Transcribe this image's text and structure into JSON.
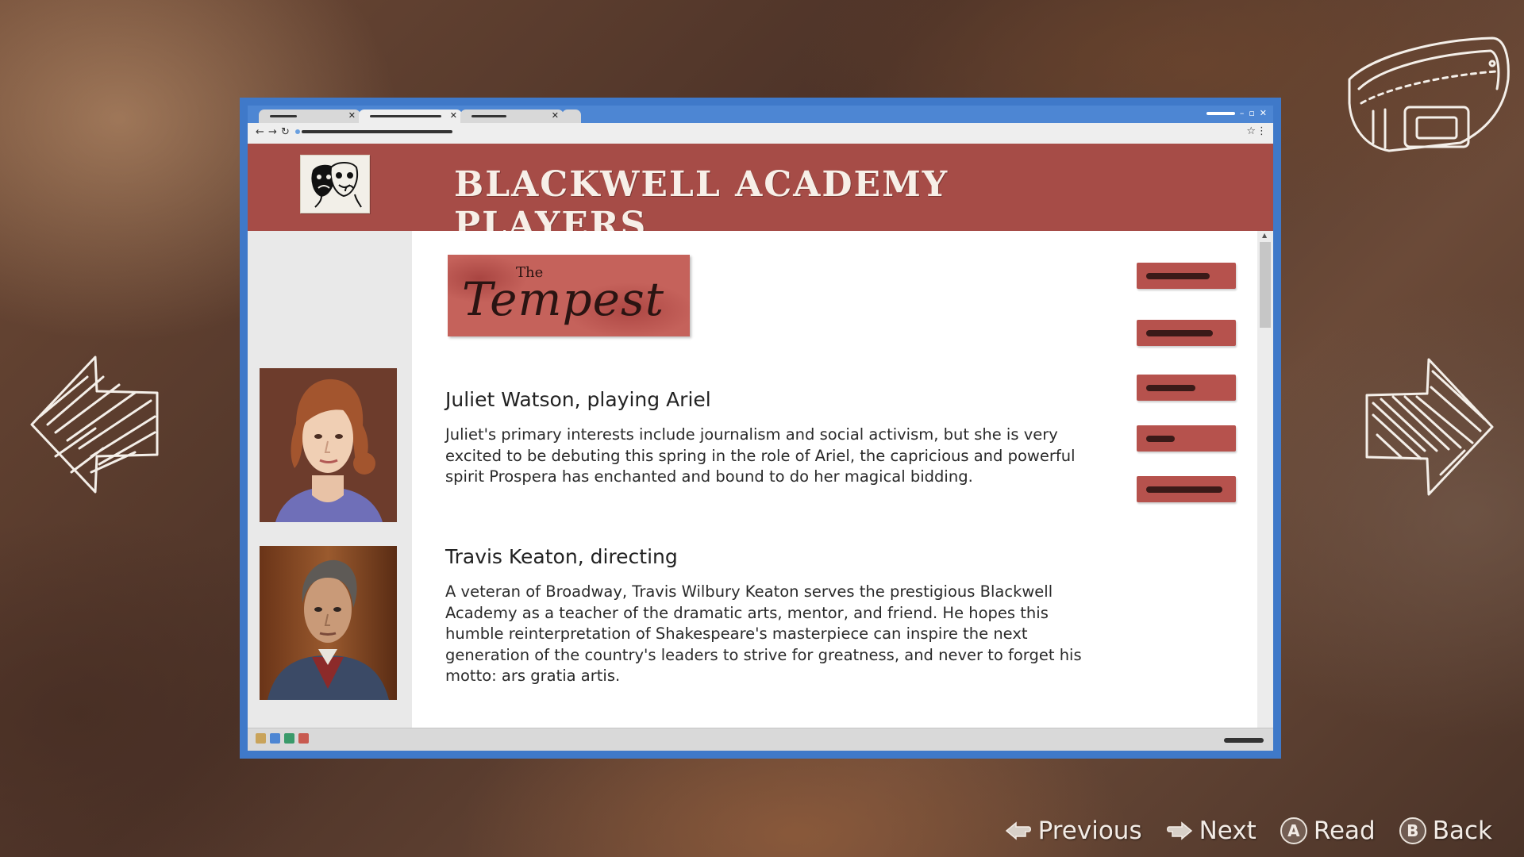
{
  "browser": {
    "tabs": [
      {
        "label": "",
        "active": false
      },
      {
        "label": "",
        "active": true
      },
      {
        "label": "",
        "active": false
      }
    ],
    "url": ""
  },
  "site": {
    "title": "BLACKWELL ACADEMY PLAYERS",
    "logo": "theater-masks-icon"
  },
  "banner": {
    "the": "The",
    "word": "Tempest"
  },
  "people": [
    {
      "name": "Juliet Watson, playing Ariel",
      "bio": "Juliet's primary interests include journalism and social activism, but she is very excited to be debuting this spring in the role of Ariel, the capricious and powerful spirit Prospera has enchanted and bound to do her magical bidding."
    },
    {
      "name": "Travis Keaton, directing",
      "bio": "A veteran of Broadway, Travis Wilbury Keaton serves the prestigious Blackwell Academy as a teacher of the dramatic arts, mentor, and friend. He hopes this humble reinterpretation of Shakespeare's masterpiece can inspire the next generation of the country's leaders to strive for greatness, and never to forget his motto: ars gratia artis."
    }
  ],
  "prompts": [
    {
      "label": "Previous",
      "icon": "left-hand-icon"
    },
    {
      "label": "Next",
      "icon": "right-hand-icon"
    },
    {
      "label": "Read",
      "button": "A"
    },
    {
      "label": "Back",
      "button": "B"
    }
  ],
  "colors": {
    "frame": "#3f79c9",
    "header": "#a64c47",
    "button": "#b6524d"
  }
}
